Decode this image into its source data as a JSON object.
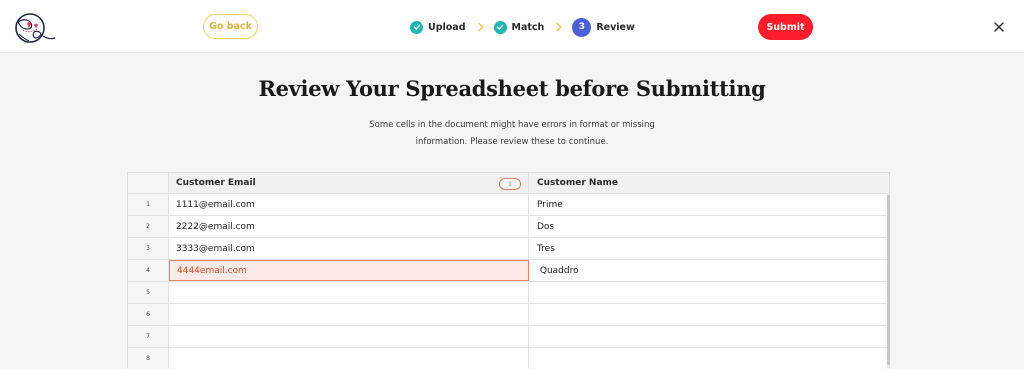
{
  "header": {
    "logo_icon": "globe-pin-logo-icon",
    "go_back_label": "Go back",
    "submit_label": "Submit",
    "close_icon": "close-icon",
    "steps": [
      {
        "label": "Upload",
        "status": "done"
      },
      {
        "label": "Match",
        "status": "done"
      },
      {
        "label": "Review",
        "status": "current",
        "number": "3"
      }
    ]
  },
  "page": {
    "title": "Review Your Spreadsheet before Submitting",
    "subtitle": "Some cells in the document might have errors in format or missing information. Please review these to continue."
  },
  "table": {
    "columns": [
      {
        "label": "Customer Email",
        "error_count": "1"
      },
      {
        "label": "Customer Name"
      }
    ],
    "rows": [
      {
        "num": "1",
        "email": "1111@email.com",
        "name": "Prime"
      },
      {
        "num": "2",
        "email": "2222@email.com",
        "name": "Dos"
      },
      {
        "num": "3",
        "email": "3333@email.com",
        "name": "Tres"
      },
      {
        "num": "4",
        "email": "4444email.com",
        "name": " Quaddro",
        "email_error": true
      },
      {
        "num": "5",
        "email": "",
        "name": ""
      },
      {
        "num": "6",
        "email": "",
        "name": ""
      },
      {
        "num": "7",
        "email": "",
        "name": ""
      },
      {
        "num": "8",
        "email": "",
        "name": ""
      }
    ]
  },
  "colors": {
    "accent_red": "#ff1c2c",
    "step_done": "#1fb5b0",
    "step_current": "#4b5fd6",
    "go_back_yellow": "#f4d35e",
    "error_text": "#d24c28",
    "error_bg": "#fdeae6"
  }
}
